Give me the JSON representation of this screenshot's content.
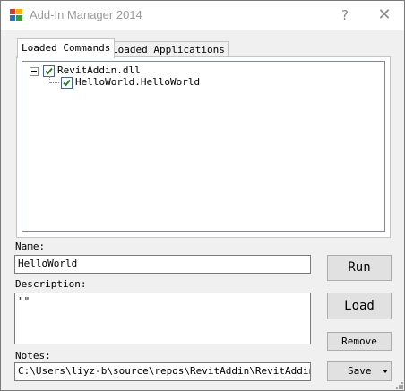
{
  "window": {
    "title": "Add-In Manager 2014",
    "help_glyph": "?",
    "close_glyph": "✕"
  },
  "tabs": [
    {
      "label": "Loaded Commands",
      "active": true
    },
    {
      "label": "Loaded Applications",
      "active": false
    }
  ],
  "tree": {
    "root": {
      "label": "RevitAddin.dll",
      "checked": true,
      "expanded": true
    },
    "children": [
      {
        "label": "HelloWorld.HelloWorld",
        "checked": true
      }
    ]
  },
  "form": {
    "name_label": "Name:",
    "name_value": "HelloWorld",
    "description_label": "Description:",
    "description_value": "\"\"",
    "notes_label": "Notes:",
    "notes_value": "C:\\Users\\liyz-b\\source\\repos\\RevitAddin\\RevitAddin\\obj\\"
  },
  "buttons": {
    "run": "Run",
    "load": "Load",
    "remove": "Remove",
    "save": "Save"
  },
  "colors": {
    "check": "#2c7a2c",
    "checkbox_border": "#4d6185",
    "button_face": "#e1e1e1"
  }
}
